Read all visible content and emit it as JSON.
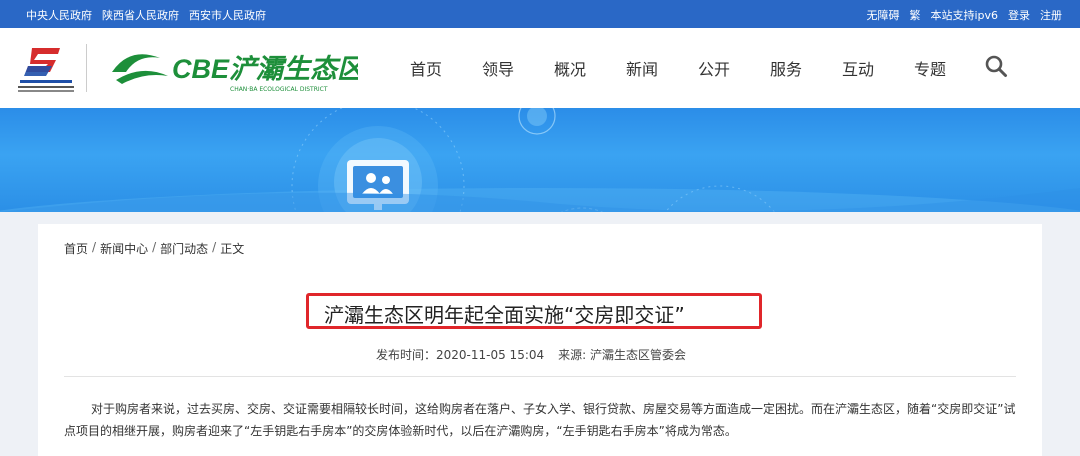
{
  "topbar": {
    "left_links": [
      "中央人民政府",
      "陕西省人民政府",
      "西安市人民政府"
    ],
    "right_links": [
      "无障碍",
      "繁",
      "本站支持ipv6",
      "登录",
      "注册"
    ]
  },
  "header": {
    "logo_text": "CBE浐灞生态区",
    "logo_subtext": "CHAN·BA ECOLOGICAL DISTRICT",
    "nav": [
      "首页",
      "领导",
      "概况",
      "新闻",
      "公开",
      "服务",
      "互动",
      "专题"
    ]
  },
  "article": {
    "breadcrumb": [
      "首页",
      "新闻中心",
      "部门动态",
      "正文"
    ],
    "title": "浐灞生态区明年起全面实施“交房即交证”",
    "publish_time": "发布时间：2020-11-05 15:04",
    "source": "来源: 浐灞生态区管委会",
    "body": "对于购房者来说，过去买房、交房、交证需要相隔较长时间，这给购房者在落户、子女入学、银行贷款、房屋交易等方面造成一定困扰。而在浐灞生态区，随着“交房即交证”试点项目的相继开展，购房者迎来了“左手钥匙右手房本”的交房体验新时代，以后在浐灞购房，“左手钥匙右手房本”将成为常态。"
  },
  "colors": {
    "topbar": "#2a68c6",
    "brand_green": "#1d8f3a",
    "highlight_red": "#e0262a",
    "banner": "#3aa3f2"
  }
}
